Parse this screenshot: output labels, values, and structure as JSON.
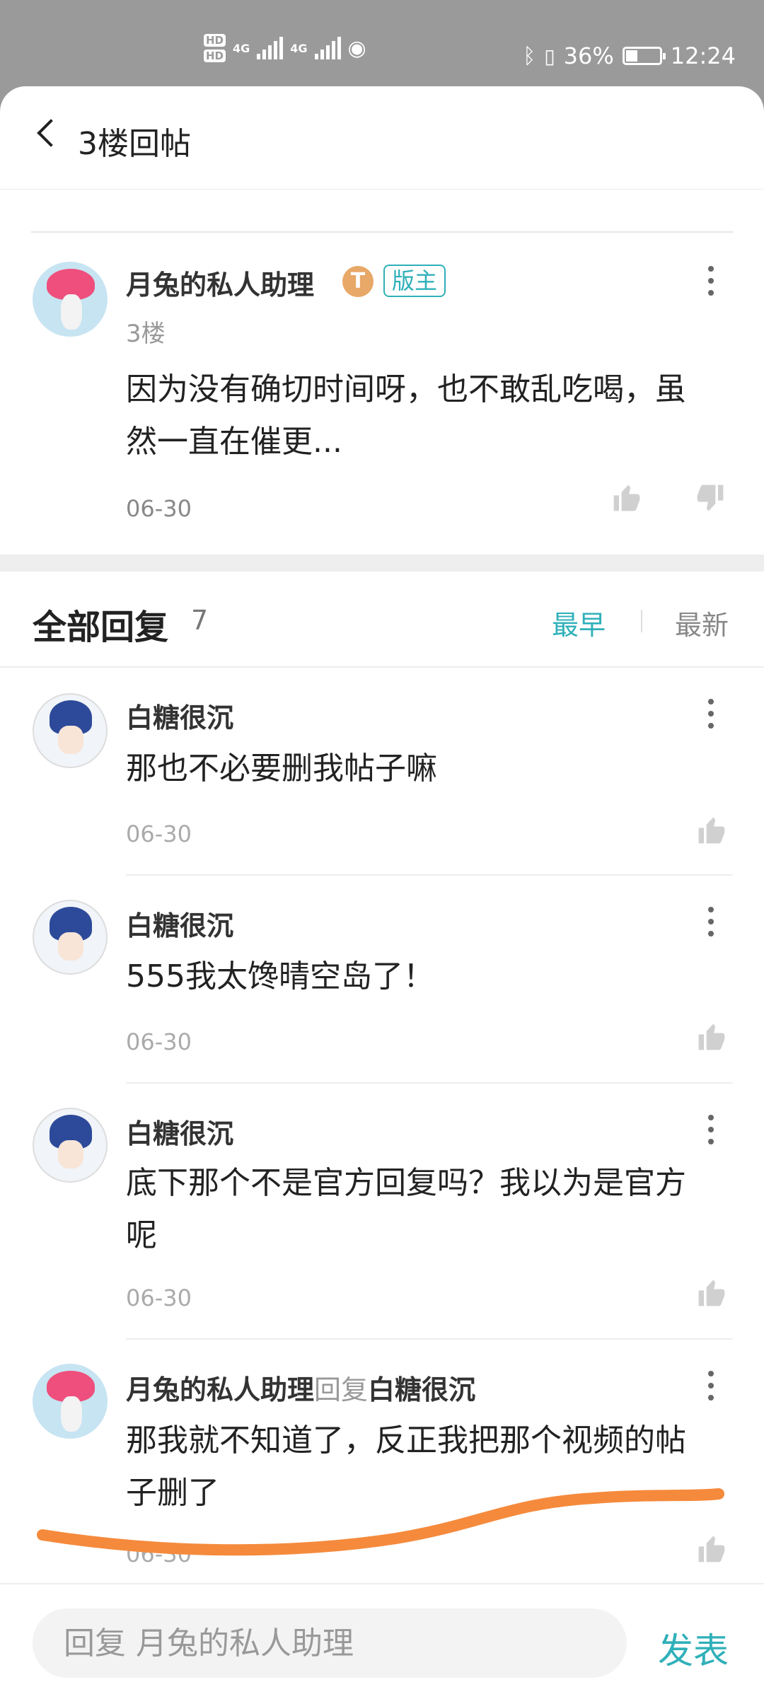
{
  "status": {
    "battery": "36%",
    "time": "12:24",
    "net1": "4G",
    "net2": "4G",
    "hd1": "HD",
    "hd2": "HD",
    "battery_level": 0.36
  },
  "header": {
    "title": "3楼回帖"
  },
  "post": {
    "author": "月兔的私人助理",
    "level_badge": "T",
    "role_badge": "版主",
    "floor": "3楼",
    "content": "因为没有确切时间呀，也不敢乱吃喝，虽然一直在催更...",
    "date": "06-30"
  },
  "replies_header": {
    "label": "全部回复",
    "count": "7",
    "sort_early": "最早",
    "sort_latest": "最新"
  },
  "replies": [
    {
      "author": "白糖很沉",
      "content": "那也不必要删我帖子嘛",
      "date": "06-30"
    },
    {
      "author": "白糖很沉",
      "content": "555我太馋晴空岛了！",
      "date": "06-30"
    },
    {
      "author": "白糖很沉",
      "content": "底下那个不是官方回复吗？我以为是官方呢",
      "date": "06-30"
    },
    {
      "author": "月兔的私人助理",
      "reply_word": "回复",
      "reply_to": "白糖很沉",
      "content": "那我就不知道了，反正我把那个视频的帖子删了",
      "date": "06-30"
    }
  ],
  "bottom": {
    "placeholder": "回复 月兔的私人助理",
    "send": "发表"
  },
  "colors": {
    "accent": "#2fb0b9",
    "annotation": "#f58a3c"
  }
}
